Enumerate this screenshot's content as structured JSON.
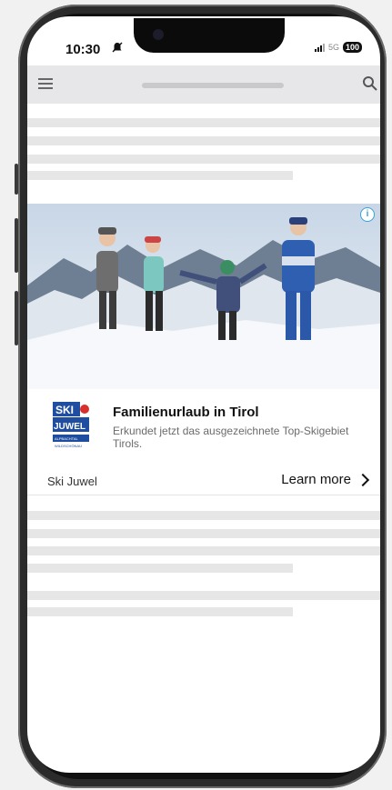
{
  "status_bar": {
    "time": "10:30",
    "network": "5G",
    "battery": "100"
  },
  "ad": {
    "adchoices_label": "i",
    "title": "Familienurlaub in Tirol",
    "description": "Erkundet jetzt das ausgezeichnete Top-Skigebiet Tirols.",
    "advertiser": "Ski Juwel",
    "cta": "Learn more",
    "logo_text_line1": "SKI",
    "logo_text_line2": "JUWEL",
    "logo_text_line3": "ALPBACHTAL WILDSCHÖNAU"
  },
  "colors": {
    "topbar_bg": "#e7e7e9",
    "placeholder": "#e6e6e6",
    "adchoices": "#3aa0d8",
    "logo_blue": "#1f4ea0",
    "logo_red": "#d8312c"
  },
  "icons": [
    "menu-icon",
    "search-icon",
    "silent-bell-icon",
    "signal-icon",
    "battery-icon",
    "adchoices-icon",
    "chevron-right-icon"
  ]
}
